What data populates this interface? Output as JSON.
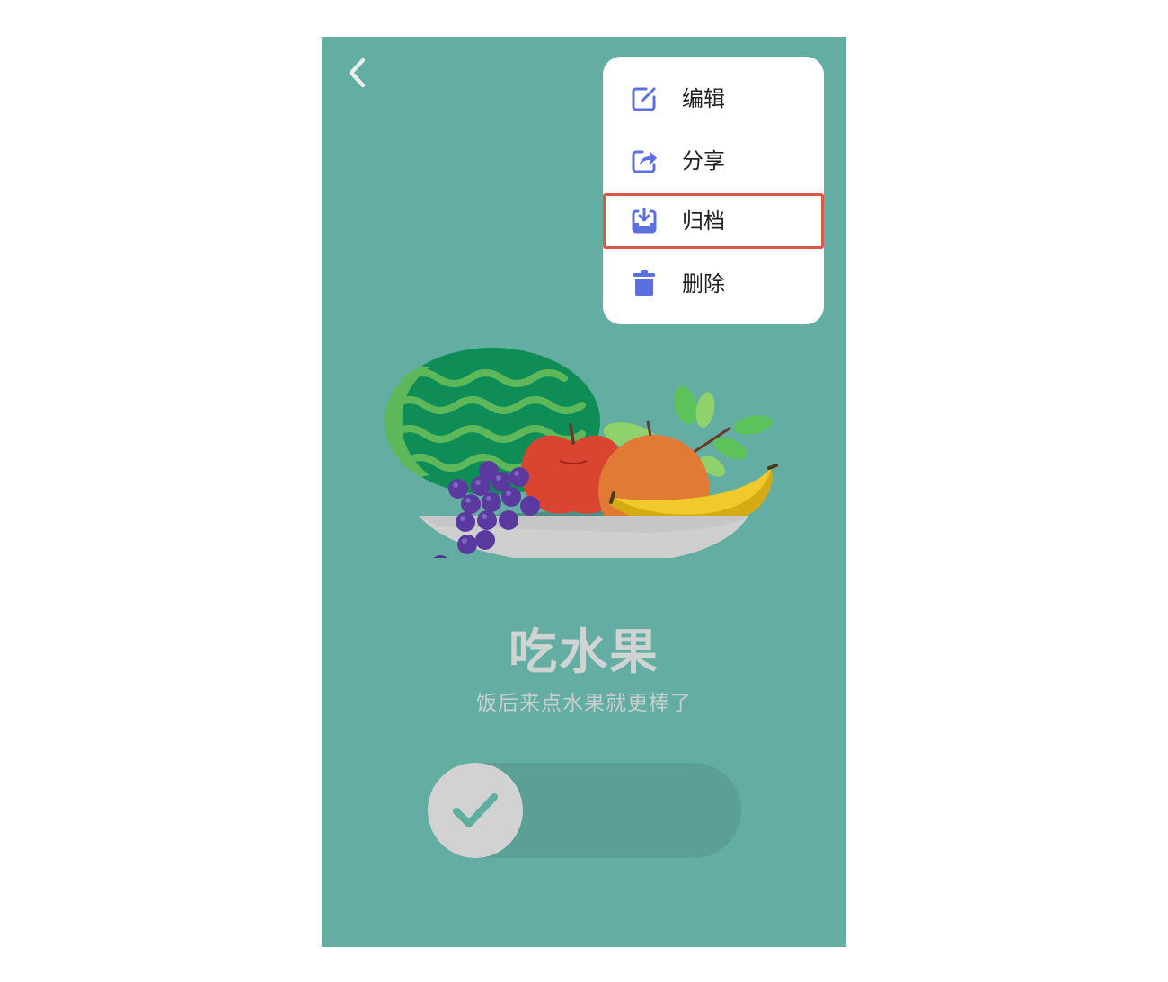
{
  "menu": {
    "items": [
      {
        "label": "编辑",
        "icon": "edit-icon"
      },
      {
        "label": "分享",
        "icon": "share-icon"
      },
      {
        "label": "归档",
        "icon": "archive-icon"
      },
      {
        "label": "删除",
        "icon": "trash-icon"
      }
    ],
    "highlighted_index": 2
  },
  "card": {
    "title": "吃水果",
    "subtitle": "饭后来点水果就更棒了"
  },
  "toggle": {
    "state": "off",
    "icon": "check-icon"
  },
  "colors": {
    "background": "#63ada3",
    "menu_icon": "#5b6fe0",
    "highlight": "#d9584a",
    "check": "#5fae9f"
  }
}
